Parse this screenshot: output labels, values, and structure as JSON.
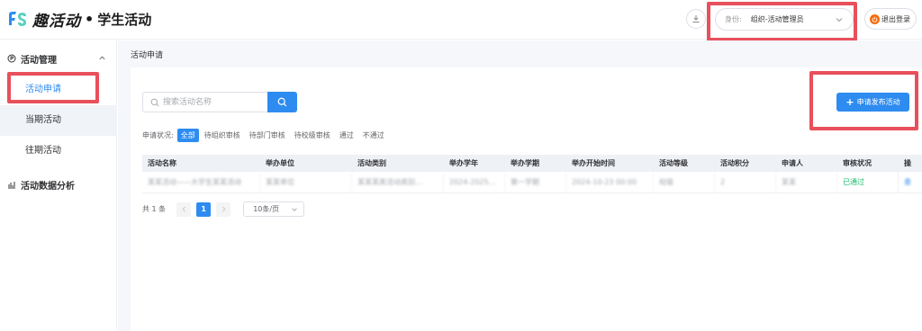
{
  "header": {
    "brand": "趣活动",
    "separator": "•",
    "subtitle": "学生活动",
    "download_icon": "download-icon",
    "role_label": "身份:",
    "role_value": "组织-活动管理员",
    "logout_label": "退出登录",
    "accent": "#2e8cf0",
    "logout_color": "#f56c0a"
  },
  "sidebar": {
    "groups": [
      {
        "label": "活动管理",
        "icon": "circle-p-icon"
      },
      {
        "label": "活动数据分析",
        "icon": "chart-icon"
      }
    ],
    "items": [
      {
        "label": "活动申请"
      },
      {
        "label": "当期活动"
      },
      {
        "label": "往期活动"
      }
    ]
  },
  "main": {
    "breadcrumb": "活动申请",
    "search_placeholder": "搜索活动名称",
    "publish_label": "申请发布活动",
    "filter_label": "申请状况:",
    "filters": [
      "全部",
      "待组织审核",
      "待部门审核",
      "待校级审核",
      "通过",
      "不通过"
    ],
    "columns": [
      "活动名称",
      "举办单位",
      "活动类别",
      "举办学年",
      "举办学期",
      "举办开始时间",
      "活动等级",
      "活动积分",
      "申请人",
      "审核状况",
      "操"
    ],
    "row": [
      "某某活动——大学生某某活动",
      "某某单位",
      "某某某类活动类别...",
      "2024-2025...",
      "第一学期",
      "2024-10-23 00:00",
      "校级",
      "2",
      "某某",
      "已通过",
      "查"
    ],
    "total": "共 1 条",
    "current_page": "1",
    "page_size": "10条/页"
  },
  "highlight_color": "#e8505b"
}
